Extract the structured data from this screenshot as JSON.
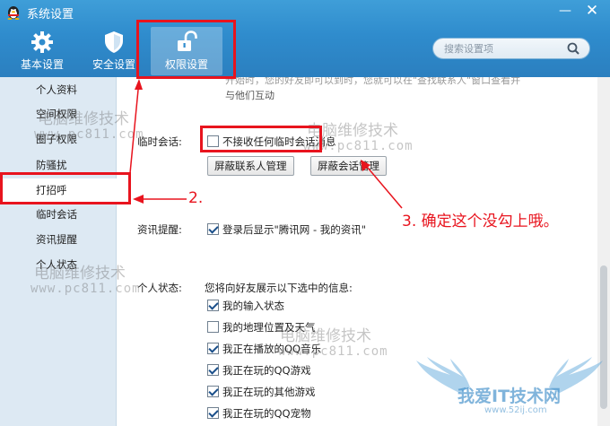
{
  "window": {
    "title": "系统设置",
    "minimize_glyph": "—",
    "close_glyph": "✕"
  },
  "tabs": [
    {
      "label": "基本设置",
      "icon": "gear-icon"
    },
    {
      "label": "安全设置",
      "icon": "shield-icon"
    },
    {
      "label": "权限设置",
      "icon": "unlock-icon",
      "selected": true
    }
  ],
  "search": {
    "placeholder": "搜索设置项"
  },
  "sidebar": {
    "items": [
      {
        "label": "个人资料"
      },
      {
        "label": "空间权限"
      },
      {
        "label": "圈子权限"
      },
      {
        "label": "防骚扰"
      },
      {
        "label": "打招呼",
        "active": true
      },
      {
        "label": "临时会话"
      },
      {
        "label": "资讯提醒"
      },
      {
        "label": "个人状态"
      }
    ]
  },
  "main": {
    "faded_top_line1": "开始时，您的好友即可以到时，您就可以在\"查找联系人\"窗口查看并",
    "faded_top_line2": "与他们互动",
    "temp_session": {
      "label": "临时会话:",
      "checkbox_label": "不接收任何临时会话消息",
      "checked": false,
      "block_contacts_button": "屏蔽联系人管理",
      "block_session_button": "屏蔽会话管理"
    },
    "news_reminder": {
      "label": "资讯提醒:",
      "checkbox_label": "登录后显示\"腾讯网 - 我的资讯\"",
      "checked": true
    },
    "personal_status": {
      "label": "个人状态:",
      "description": "您将向好友展示以下选中的信息:",
      "options": [
        {
          "label": "我的输入状态",
          "checked": true
        },
        {
          "label": "我的地理位置及天气",
          "checked": false
        },
        {
          "label": "我正在播放的QQ音乐",
          "checked": true
        },
        {
          "label": "我正在玩的QQ游戏",
          "checked": true
        },
        {
          "label": "我正在玩的其他游戏",
          "checked": true
        },
        {
          "label": "我正在玩的QQ宠物",
          "checked": true
        }
      ]
    }
  },
  "annotations": {
    "step2": "2.",
    "step3": "3. 确定这个没勾上哦。"
  },
  "watermarks": {
    "cn": "电脑维修技术",
    "url": "www.pc811.com",
    "brand_text": "我爱IT技术网",
    "brand_url": "www.52ij.com"
  },
  "colors": {
    "header_blue": "#2f8ccd",
    "annotation_red": "#e8141e",
    "sidebar_bg": "#dde9f3"
  }
}
